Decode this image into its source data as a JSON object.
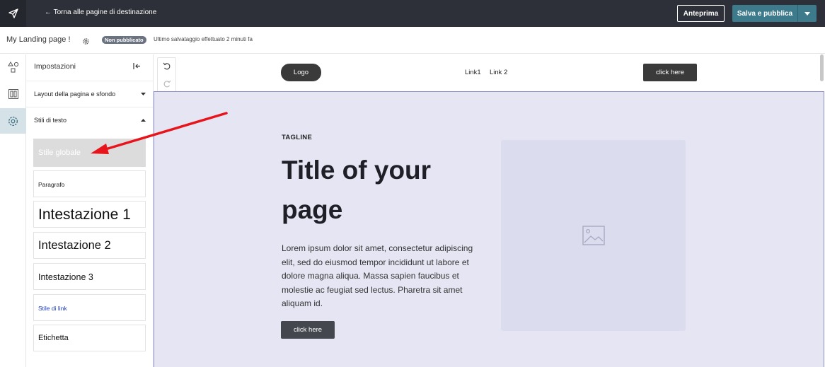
{
  "topbar": {
    "back_label": "← Torna alle pagine di destinazione",
    "preview_label": "Anteprima",
    "publish_label": "Salva e pubblica"
  },
  "subbar": {
    "page_name": "My Landing page !",
    "status_badge": "Non pubblicato",
    "saved_text": "Ultimo salvataggio effettuato 2 minuti fa"
  },
  "panel": {
    "title": "Impostazioni",
    "sections": [
      {
        "label": "Layout della pagina e sfondo",
        "expanded": false
      },
      {
        "label": "Stili di testo",
        "expanded": true
      }
    ],
    "text_styles": [
      {
        "label": "Stile globale",
        "selected": true
      },
      {
        "label": "Paragrafo"
      },
      {
        "label": "Intestazione 1"
      },
      {
        "label": "Intestazione 2"
      },
      {
        "label": "Intestazione 3"
      },
      {
        "label": "Stile di link"
      },
      {
        "label": "Etichetta"
      }
    ]
  },
  "site": {
    "logo_label": "Logo",
    "links": [
      "Link1",
      "Link 2"
    ],
    "nav_button": "click here",
    "tagline": "TAGLINE",
    "title": "Title of your page",
    "body": "Lorem ipsum dolor sit amet, consectetur adipiscing elit, sed do eiusmod tempor incididunt ut labore et dolore magna aliqua. Massa sapien faucibus et molestie ac feugiat sed lectus. Pharetra sit amet aliquam id.",
    "hero_button": "click here"
  },
  "colors": {
    "topbar": "#2d3038",
    "publish": "#3c7a8c",
    "hero_bg": "#e5e5f3",
    "selection": "#8e8ecb",
    "annotation_arrow": "#e8141b"
  },
  "icons": [
    "send-icon",
    "caret-down-icon",
    "gear-icon",
    "shapes-icon",
    "layout-icon",
    "settings-icon",
    "collapse-left-icon",
    "undo-icon",
    "redo-icon",
    "image-placeholder-icon"
  ]
}
